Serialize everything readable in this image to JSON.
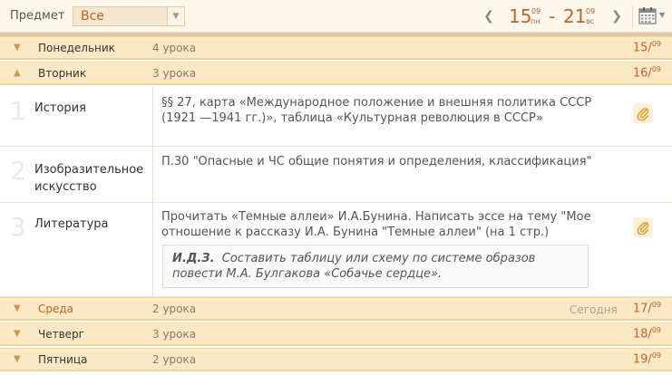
{
  "topbar": {
    "subject_label": "Предмет",
    "subject_value": "Все",
    "week_start_day": "15",
    "week_start_month": "09",
    "week_start_dow": "пн",
    "week_dash": "-",
    "week_end_day": "21",
    "week_end_month": "09",
    "week_end_dow": "вс"
  },
  "days": [
    {
      "name": "Понедельник",
      "count": "4 урока",
      "date_day": "15",
      "date_month": "09"
    },
    {
      "name": "Вторник",
      "count": "3 урока",
      "date_day": "16",
      "date_month": "09"
    },
    {
      "name": "Среда",
      "count": "2 урока",
      "today": "Сегодня",
      "date_day": "17",
      "date_month": "09"
    },
    {
      "name": "Четверг",
      "count": "3 урока",
      "date_day": "18",
      "date_month": "09"
    },
    {
      "name": "Пятница",
      "count": "2 урока",
      "date_day": "19",
      "date_month": "09"
    }
  ],
  "lessons": [
    {
      "num": "1",
      "subject": "История",
      "homework": "§§ 27, карта «Международное положение и внешняя политика СССР (1921 —1941 гг.)», таблица «Культурная революция в СССР»"
    },
    {
      "num": "2",
      "subject": "Изобразительное искусство",
      "homework": "П.30 \"Опасные и ЧС общие понятия и определения, классификация\""
    },
    {
      "num": "3",
      "subject": "Литература",
      "homework": "Прочитать «Темные аллеи» И.А.Бунина. Написать эссе на тему \"Мое отношение к рассказу И.А. Бунина \"Темные аллеи\" (на 1 стр.)",
      "ids_label": "И.Д.З.",
      "ids_text": "Составить таблицу или схему по системе образов повести М.А. Булгакова «Собачье сердце»."
    }
  ],
  "colors": {
    "accent": "#c0622a",
    "day_header_bg": "#fbe8c4",
    "topbar_bg": "#fdf8ec"
  }
}
